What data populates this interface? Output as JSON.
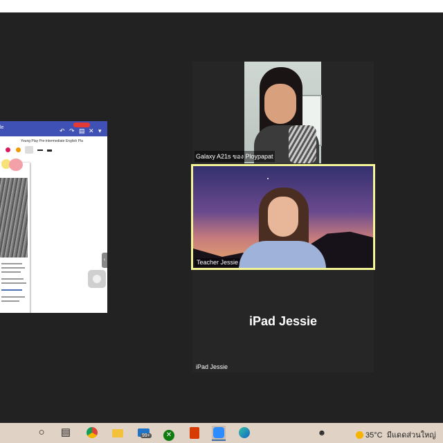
{
  "participants": [
    {
      "label": "Galaxy A21s ของ Ploypapat"
    },
    {
      "label": "Teacher Jessie"
    },
    {
      "label": "iPad Jessie",
      "display_name": "iPad Jessie"
    }
  ],
  "shared_screen": {
    "tab_fragment": "le",
    "document_title": "Young Play Pre-intermediate English Pla"
  },
  "taskbar": {
    "notification_badge": "99+",
    "temperature": "35°C",
    "weather_text": "มีแดดส่วนใหญ่"
  },
  "colors": {
    "active_speaker_border": "#f3f596",
    "share_header": "#3f51b5",
    "taskbar": "#e0d3c5"
  }
}
